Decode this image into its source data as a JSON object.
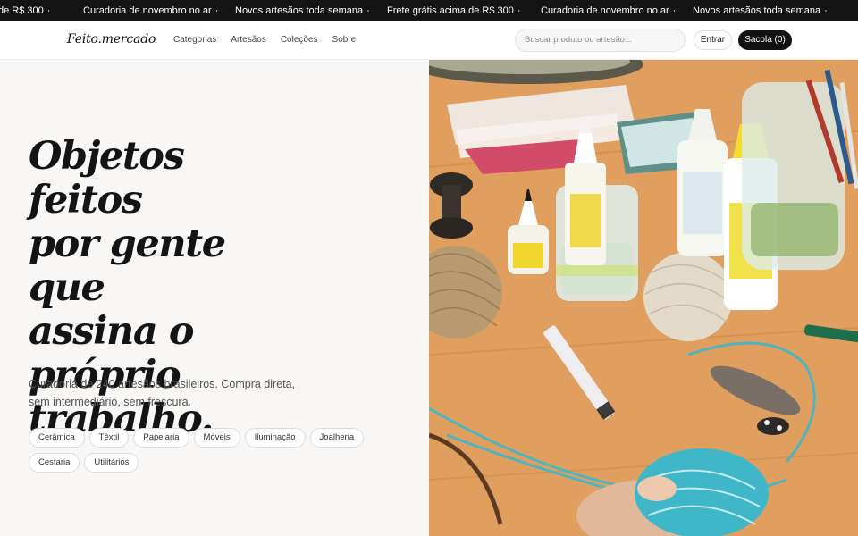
{
  "ticker": {
    "items": [
      "de R$ 300",
      "Curadoria de novembro no ar",
      "Novos artesãos toda semana",
      "Frete grátis acima de R$ 300",
      "Curadoria de novembro no ar",
      "Novos artesãos toda semana"
    ],
    "separator": "·"
  },
  "nav": {
    "logo": "Feito.mercado",
    "links": [
      "Categorias",
      "Artesãos",
      "Coleções",
      "Sobre"
    ],
    "search_placeholder": "Buscar produto ou artesão...",
    "login_label": "Entrar",
    "bag_label": "Sacola (0)"
  },
  "hero": {
    "headline_lines": [
      "Objetos feitos",
      "por gente que",
      "assina o",
      "próprio",
      "trabalho."
    ],
    "subtext_lines": [
      "Curadoria de 240 artesãos brasileiros. Compra direta,",
      "sem intermediário, sem frescura."
    ],
    "categories": [
      "Cerâmica",
      "Têxtil",
      "Papelaria",
      "Móveis",
      "Iluminação",
      "Joalheria",
      "Cestaria",
      "Utilitários"
    ]
  },
  "colors": {
    "ticker_bg": "#141414",
    "bag_button_bg": "#121212",
    "table_wood": "#e6a865",
    "twine_teal": "#3fb7c9"
  }
}
